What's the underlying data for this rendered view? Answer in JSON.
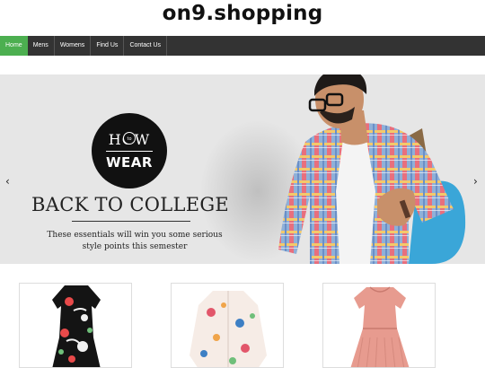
{
  "site": {
    "title": "on9.shopping"
  },
  "nav": {
    "items": [
      {
        "label": "Home",
        "active": true
      },
      {
        "label": "Mens",
        "active": false
      },
      {
        "label": "Womens",
        "active": false
      },
      {
        "label": "Find Us",
        "active": false
      },
      {
        "label": "Contact Us",
        "active": false
      }
    ],
    "colors": {
      "bar": "#333333",
      "active": "#4caf50"
    }
  },
  "banner": {
    "badge_top": "HOW",
    "badge_small": "to",
    "badge_bottom": "WEAR",
    "heading": "BACK TO COLLEGE",
    "subtitle_line1": "These essentials will win you some serious",
    "subtitle_line2": "style points this semester",
    "prev_arrow": "‹",
    "next_arrow": "›"
  },
  "products": [
    {
      "name": "floral-black-dress-image"
    },
    {
      "name": "floral-white-blouse-image"
    },
    {
      "name": "pink-knit-dress-image"
    }
  ]
}
